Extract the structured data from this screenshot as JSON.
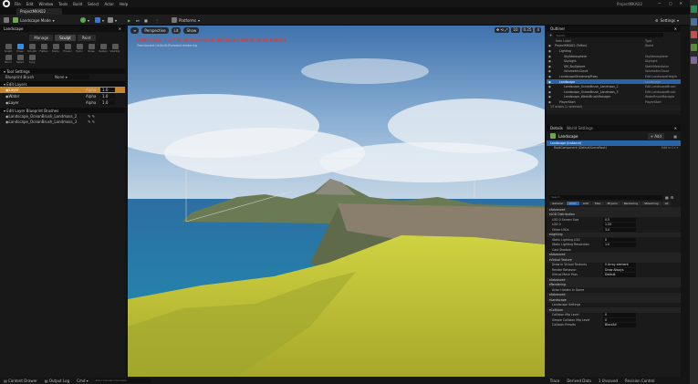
{
  "menubar": {
    "items": [
      "File",
      "Edit",
      "Window",
      "Tools",
      "Build",
      "Select",
      "Actor",
      "Help"
    ],
    "project_title": "ProjectMKAD2"
  },
  "tabs": {
    "project": "ProjectMKAD2"
  },
  "toolbar": {
    "mode": "Landscape Mode",
    "platforms": "Platforms",
    "settings": "Settings"
  },
  "left_panel": {
    "title": "Landscape",
    "modes": [
      "Manage",
      "Sculpt",
      "Paint"
    ],
    "active_mode": "Sculpt",
    "tools": [
      "Sculpt",
      "Erase",
      "Smooth",
      "Flatten",
      "Ramp",
      "Erosion",
      "Hydro",
      "Noise",
      "Retopo",
      "Visibility",
      "Mirror",
      "Select",
      "Copy"
    ],
    "active_tool": "Erase",
    "tool_settings": "Tool Settings",
    "blueprint_brush_label": "Blueprint Brush",
    "blueprint_brush_value": "None",
    "edit_layers": "Edit Layers",
    "layers": [
      {
        "name": "Layer",
        "alpha_label": "Alpha",
        "alpha": "1.0",
        "selected": true
      },
      {
        "name": "Water",
        "alpha_label": "Alpha",
        "alpha": "1.0",
        "selected": false
      },
      {
        "name": "Layer",
        "alpha_label": "Alpha",
        "alpha": "1.0",
        "selected": false
      }
    ],
    "brushes_title": "Edit Layer Blueprint Brushes",
    "brushes": [
      "Landscape_OceanBrush_Landmass_2",
      "Landscape_OceanBrush_Landmass_3"
    ]
  },
  "viewport": {
    "perspective": "Perspective",
    "lit": "Lit",
    "show": "Show",
    "warning": "LANDSCAPE: 1 ACTOR WITH PHYSICAL MATERIALS NEEDS TO BE REBUILT",
    "warning_sub": "Translucent Lit/Unlit/Forward rendering",
    "right_values": [
      "10",
      "0.25",
      "4"
    ]
  },
  "outliner": {
    "title": "Outliner",
    "search_placeholder": "Search...",
    "col_item": "Item Label",
    "col_type": "Type",
    "rows": [
      {
        "label": "ProjectMKAD2 (Editor)",
        "type": "World",
        "indent": 1
      },
      {
        "label": "Lighting",
        "type": "",
        "indent": 2
      },
      {
        "label": "SkyAtmosphere",
        "type": "SkyAtmosphere",
        "indent": 3
      },
      {
        "label": "SkyLight",
        "type": "SkyLight",
        "indent": 3
      },
      {
        "label": "SM_SkySphere",
        "type": "StaticMeshActor",
        "indent": 3
      },
      {
        "label": "VolumetricCloud",
        "type": "VolumetricCloud",
        "indent": 3
      },
      {
        "label": "LandscapeStreamingProxy",
        "type": "Edit LandscapeHeight",
        "indent": 2
      },
      {
        "label": "Landscape",
        "type": "Landscape",
        "indent": 2,
        "selected": true
      },
      {
        "label": "Landscape_OceanBrush_Landmass_2",
        "type": "Edit LandscapeBrush",
        "indent": 3
      },
      {
        "label": "Landscape_OceanBrush_Landmass_3",
        "type": "Edit LandscapeBrush",
        "indent": 3
      },
      {
        "label": "Landscape_WaterBrushManager",
        "type": "WaterBrushManager",
        "indent": 3
      },
      {
        "label": "PlayerStart",
        "type": "PlayerStart",
        "indent": 2
      }
    ],
    "footer": "13 actors (1 selected)"
  },
  "details": {
    "title": "Details",
    "world_settings": "World Settings",
    "actor": "Landscape",
    "add": "+ Add",
    "instance": "Landscape (Instance)",
    "root": "RootComponent (DefaultSceneRoot)",
    "edit_cpp": "Edit in C++",
    "search_placeholder": "Search",
    "tabs": [
      "General",
      "Actor",
      "LOD",
      "Misc",
      "Physics",
      "Rendering",
      "Streaming",
      "All"
    ],
    "active_tab": "Actor",
    "sections": [
      {
        "title": "Advanced",
        "rows": []
      },
      {
        "title": "LOD Distribution",
        "rows": [
          {
            "label": "LOD 0 Screen Size",
            "value": "0.5"
          },
          {
            "label": "LOD 0",
            "value": "1.25"
          },
          {
            "label": "Other LODs",
            "value": "3.0"
          }
        ]
      },
      {
        "title": "Lighting",
        "rows": [
          {
            "label": "Static Lighting LOD",
            "value": "0"
          },
          {
            "label": "Static Lighting Resolution",
            "value": "1.0"
          },
          {
            "label": "Cast Shadow",
            "value": ""
          }
        ]
      },
      {
        "title": "Advanced",
        "rows": []
      },
      {
        "title": "Virtual Texture",
        "rows": [
          {
            "label": "Draw in Virtual Textures",
            "value": "0 Array element"
          },
          {
            "label": "Render Behavior",
            "value": "Draw Always"
          },
          {
            "label": "Virtual Mesh Pass",
            "value": "Default"
          }
        ]
      },
      {
        "title": "Advanced",
        "rows": []
      },
      {
        "title": "Rendering",
        "rows": [
          {
            "label": "Actor Hidden In Game",
            "value": ""
          }
        ]
      },
      {
        "title": "Advanced",
        "rows": []
      },
      {
        "title": "Landscape",
        "rows": [
          {
            "label": "Landscape Settings",
            "value": ""
          }
        ]
      },
      {
        "title": "Collision",
        "rows": [
          {
            "label": "Collision Mip Level",
            "value": "0"
          },
          {
            "label": "Simple Collision Mip Level",
            "value": "0"
          },
          {
            "label": "Collision Presets",
            "value": "BlockAll"
          }
        ]
      }
    ]
  },
  "statusbar": {
    "content_drawer": "Content Drawer",
    "output_log": "Output Log",
    "cmd": "Cmd",
    "console_placeholder": "Enter Console Command",
    "trace": "Trace",
    "derived": "Derived Data",
    "unsaved": "1 Unsaved",
    "revision": "Revision Control"
  }
}
